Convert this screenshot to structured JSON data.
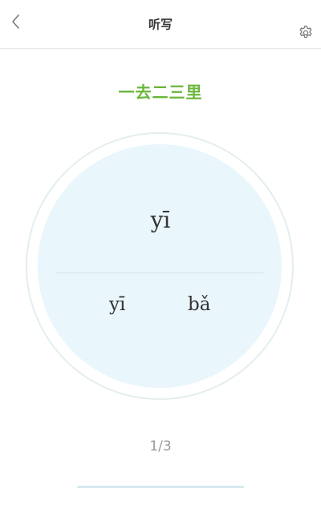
{
  "nav": {
    "title": "听写",
    "back_icon": "chevron-left-icon",
    "settings_icon": "gear-icon"
  },
  "lesson": {
    "title": "一去二三里"
  },
  "question": {
    "pinyin": "yī"
  },
  "options": [
    {
      "label": "yī"
    },
    {
      "label": "bǎ"
    }
  ],
  "progress": {
    "text": "1/3",
    "current": 1,
    "total": 3
  },
  "colors": {
    "accent_green": "#69b63a",
    "circle_fill": "#e9f6fb",
    "progress_track": "#d6e9ef"
  }
}
